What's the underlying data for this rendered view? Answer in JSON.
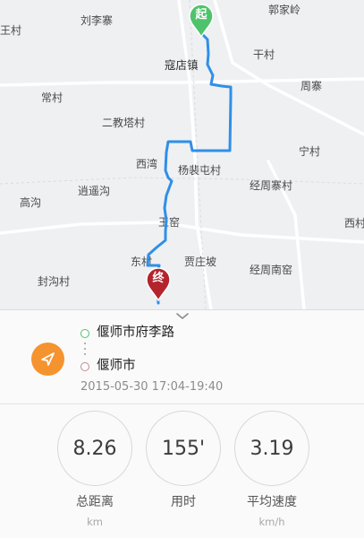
{
  "map": {
    "places": [
      "郭家岭",
      "刘李寨",
      "王村",
      "寇店镇",
      "干村",
      "常村",
      "周寨",
      "二教塔村",
      "宁村",
      "西湾",
      "杨裴屯村",
      "逍遥沟",
      "经周寨村",
      "高沟",
      "王窑",
      "西村",
      "东村",
      "贾庄坡",
      "经周南窑",
      "封沟村"
    ],
    "start_marker": "起",
    "end_marker": "终",
    "route_color": "#2f8fe8"
  },
  "trip": {
    "start_address": "偃师市府李路",
    "end_address": "偃师市",
    "time_range": "2015-05-30 17:04-19:40"
  },
  "stats": [
    {
      "value": "8.26",
      "label": "总距离",
      "unit": "km"
    },
    {
      "value": "155'",
      "label": "用时",
      "unit": ""
    },
    {
      "value": "3.19",
      "label": "平均速度",
      "unit": "km/h"
    }
  ],
  "icons": {
    "nav": "navigation-arrow-icon",
    "handle": "chevron-down-icon"
  },
  "colors": {
    "start": "#4fc36b",
    "end": "#b3242c",
    "accent": "#f5932f"
  }
}
